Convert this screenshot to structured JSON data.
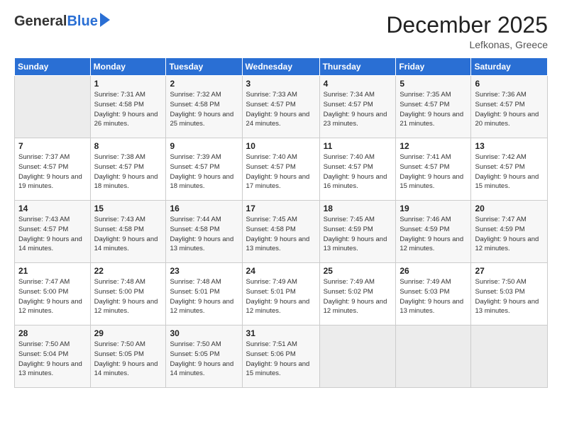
{
  "logo": {
    "general": "General",
    "blue": "Blue"
  },
  "header": {
    "title": "December 2025",
    "location": "Lefkonas, Greece"
  },
  "days_of_week": [
    "Sunday",
    "Monday",
    "Tuesday",
    "Wednesday",
    "Thursday",
    "Friday",
    "Saturday"
  ],
  "weeks": [
    [
      {
        "day": "",
        "sunrise": "",
        "sunset": "",
        "daylight": "",
        "empty": true
      },
      {
        "day": "1",
        "sunrise": "Sunrise: 7:31 AM",
        "sunset": "Sunset: 4:58 PM",
        "daylight": "Daylight: 9 hours and 26 minutes."
      },
      {
        "day": "2",
        "sunrise": "Sunrise: 7:32 AM",
        "sunset": "Sunset: 4:58 PM",
        "daylight": "Daylight: 9 hours and 25 minutes."
      },
      {
        "day": "3",
        "sunrise": "Sunrise: 7:33 AM",
        "sunset": "Sunset: 4:57 PM",
        "daylight": "Daylight: 9 hours and 24 minutes."
      },
      {
        "day": "4",
        "sunrise": "Sunrise: 7:34 AM",
        "sunset": "Sunset: 4:57 PM",
        "daylight": "Daylight: 9 hours and 23 minutes."
      },
      {
        "day": "5",
        "sunrise": "Sunrise: 7:35 AM",
        "sunset": "Sunset: 4:57 PM",
        "daylight": "Daylight: 9 hours and 21 minutes."
      },
      {
        "day": "6",
        "sunrise": "Sunrise: 7:36 AM",
        "sunset": "Sunset: 4:57 PM",
        "daylight": "Daylight: 9 hours and 20 minutes."
      }
    ],
    [
      {
        "day": "7",
        "sunrise": "Sunrise: 7:37 AM",
        "sunset": "Sunset: 4:57 PM",
        "daylight": "Daylight: 9 hours and 19 minutes."
      },
      {
        "day": "8",
        "sunrise": "Sunrise: 7:38 AM",
        "sunset": "Sunset: 4:57 PM",
        "daylight": "Daylight: 9 hours and 18 minutes."
      },
      {
        "day": "9",
        "sunrise": "Sunrise: 7:39 AM",
        "sunset": "Sunset: 4:57 PM",
        "daylight": "Daylight: 9 hours and 18 minutes."
      },
      {
        "day": "10",
        "sunrise": "Sunrise: 7:40 AM",
        "sunset": "Sunset: 4:57 PM",
        "daylight": "Daylight: 9 hours and 17 minutes."
      },
      {
        "day": "11",
        "sunrise": "Sunrise: 7:40 AM",
        "sunset": "Sunset: 4:57 PM",
        "daylight": "Daylight: 9 hours and 16 minutes."
      },
      {
        "day": "12",
        "sunrise": "Sunrise: 7:41 AM",
        "sunset": "Sunset: 4:57 PM",
        "daylight": "Daylight: 9 hours and 15 minutes."
      },
      {
        "day": "13",
        "sunrise": "Sunrise: 7:42 AM",
        "sunset": "Sunset: 4:57 PM",
        "daylight": "Daylight: 9 hours and 15 minutes."
      }
    ],
    [
      {
        "day": "14",
        "sunrise": "Sunrise: 7:43 AM",
        "sunset": "Sunset: 4:57 PM",
        "daylight": "Daylight: 9 hours and 14 minutes."
      },
      {
        "day": "15",
        "sunrise": "Sunrise: 7:43 AM",
        "sunset": "Sunset: 4:58 PM",
        "daylight": "Daylight: 9 hours and 14 minutes."
      },
      {
        "day": "16",
        "sunrise": "Sunrise: 7:44 AM",
        "sunset": "Sunset: 4:58 PM",
        "daylight": "Daylight: 9 hours and 13 minutes."
      },
      {
        "day": "17",
        "sunrise": "Sunrise: 7:45 AM",
        "sunset": "Sunset: 4:58 PM",
        "daylight": "Daylight: 9 hours and 13 minutes."
      },
      {
        "day": "18",
        "sunrise": "Sunrise: 7:45 AM",
        "sunset": "Sunset: 4:59 PM",
        "daylight": "Daylight: 9 hours and 13 minutes."
      },
      {
        "day": "19",
        "sunrise": "Sunrise: 7:46 AM",
        "sunset": "Sunset: 4:59 PM",
        "daylight": "Daylight: 9 hours and 12 minutes."
      },
      {
        "day": "20",
        "sunrise": "Sunrise: 7:47 AM",
        "sunset": "Sunset: 4:59 PM",
        "daylight": "Daylight: 9 hours and 12 minutes."
      }
    ],
    [
      {
        "day": "21",
        "sunrise": "Sunrise: 7:47 AM",
        "sunset": "Sunset: 5:00 PM",
        "daylight": "Daylight: 9 hours and 12 minutes."
      },
      {
        "day": "22",
        "sunrise": "Sunrise: 7:48 AM",
        "sunset": "Sunset: 5:00 PM",
        "daylight": "Daylight: 9 hours and 12 minutes."
      },
      {
        "day": "23",
        "sunrise": "Sunrise: 7:48 AM",
        "sunset": "Sunset: 5:01 PM",
        "daylight": "Daylight: 9 hours and 12 minutes."
      },
      {
        "day": "24",
        "sunrise": "Sunrise: 7:49 AM",
        "sunset": "Sunset: 5:01 PM",
        "daylight": "Daylight: 9 hours and 12 minutes."
      },
      {
        "day": "25",
        "sunrise": "Sunrise: 7:49 AM",
        "sunset": "Sunset: 5:02 PM",
        "daylight": "Daylight: 9 hours and 12 minutes."
      },
      {
        "day": "26",
        "sunrise": "Sunrise: 7:49 AM",
        "sunset": "Sunset: 5:03 PM",
        "daylight": "Daylight: 9 hours and 13 minutes."
      },
      {
        "day": "27",
        "sunrise": "Sunrise: 7:50 AM",
        "sunset": "Sunset: 5:03 PM",
        "daylight": "Daylight: 9 hours and 13 minutes."
      }
    ],
    [
      {
        "day": "28",
        "sunrise": "Sunrise: 7:50 AM",
        "sunset": "Sunset: 5:04 PM",
        "daylight": "Daylight: 9 hours and 13 minutes."
      },
      {
        "day": "29",
        "sunrise": "Sunrise: 7:50 AM",
        "sunset": "Sunset: 5:05 PM",
        "daylight": "Daylight: 9 hours and 14 minutes."
      },
      {
        "day": "30",
        "sunrise": "Sunrise: 7:50 AM",
        "sunset": "Sunset: 5:05 PM",
        "daylight": "Daylight: 9 hours and 14 minutes."
      },
      {
        "day": "31",
        "sunrise": "Sunrise: 7:51 AM",
        "sunset": "Sunset: 5:06 PM",
        "daylight": "Daylight: 9 hours and 15 minutes."
      },
      {
        "day": "",
        "sunrise": "",
        "sunset": "",
        "daylight": "",
        "empty": true
      },
      {
        "day": "",
        "sunrise": "",
        "sunset": "",
        "daylight": "",
        "empty": true
      },
      {
        "day": "",
        "sunrise": "",
        "sunset": "",
        "daylight": "",
        "empty": true
      }
    ]
  ]
}
